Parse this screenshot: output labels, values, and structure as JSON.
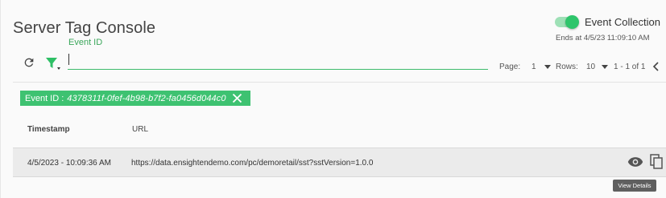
{
  "header": {
    "title": "Server Tag Console",
    "event_collection_label": "Event Collection",
    "event_collection_on": true,
    "ends_at": "Ends at 4/5/23 11:09:10 AM"
  },
  "toolbar": {
    "refresh_icon": "refresh-icon",
    "filter_icon": "filter-icon",
    "field_label": "Event ID",
    "search_value": ""
  },
  "pagination": {
    "page_label": "Page:",
    "page_value": "1",
    "rows_label": "Rows:",
    "rows_value": "10",
    "range_text": "1 - 1 of 1"
  },
  "filter_chip": {
    "key": "Event ID :",
    "value": "4378311f-0fef-4b98-b7f2-fa0456d044c0"
  },
  "table": {
    "columns": [
      "Timestamp",
      "URL"
    ],
    "rows": [
      {
        "timestamp": "4/5/2023 - 10:09:36 AM",
        "url": "https://data.ensightendemo.com/pc/demoretail/sst?sstVersion=1.0.0"
      }
    ]
  },
  "tooltip": "View Details",
  "colors": {
    "accent": "#3ec271",
    "row_bg": "#ebebeb"
  }
}
